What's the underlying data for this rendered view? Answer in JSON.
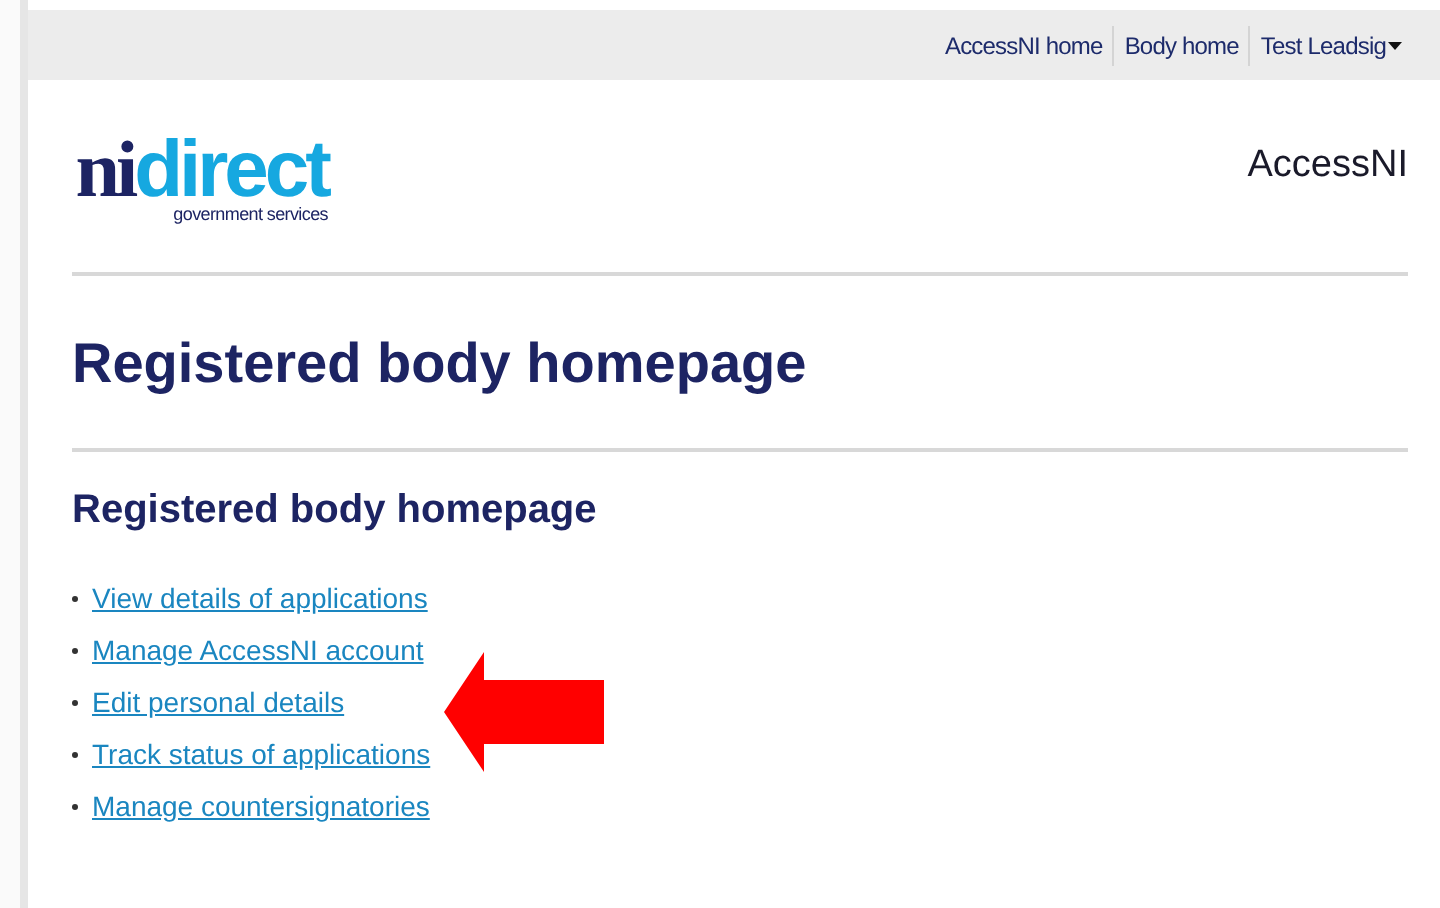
{
  "top_bar": {
    "links": [
      "AccessNI home",
      "Body home"
    ],
    "user_menu": "Test Leadsig"
  },
  "logo": {
    "part_1": "ni",
    "part_2": "direct",
    "tagline": "government services"
  },
  "service_name": "AccessNI",
  "page_title": "Registered body homepage",
  "section_title": "Registered body homepage",
  "links": [
    "View details of applications",
    "Manage AccessNI account",
    "Edit personal details",
    "Track status of applications",
    "Manage countersignatories"
  ]
}
